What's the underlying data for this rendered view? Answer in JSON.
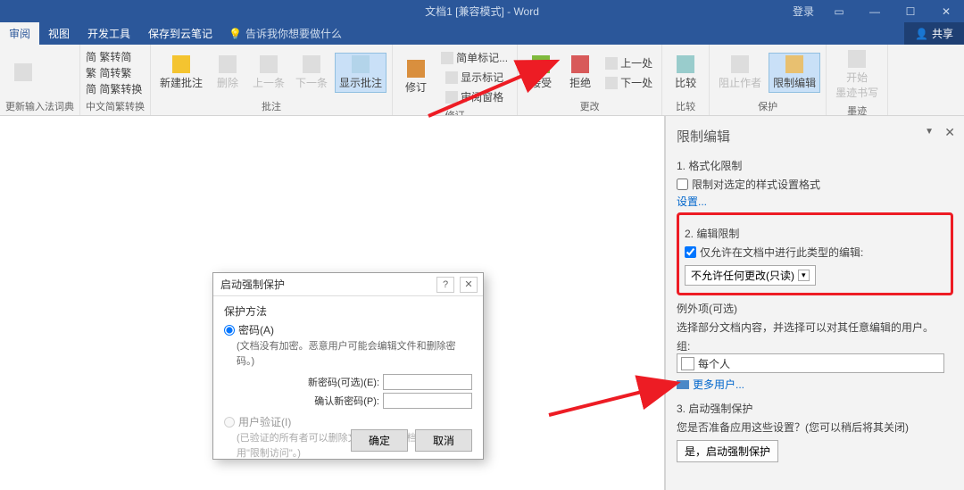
{
  "title": "文档1 [兼容模式] - Word",
  "login": "登录",
  "share": "共享",
  "tabs": {
    "review": "审阅",
    "view": "视图",
    "devtools": "开发工具",
    "save": "保存到云笔记",
    "tell": "告诉我你想要做什么"
  },
  "ribbon": {
    "group1_label": "更新输入法词典",
    "conv": {
      "a": "简 繁转简",
      "b": "繁 简转繁",
      "c": "简 简繁转换",
      "label": "中文简繁转换"
    },
    "comments": {
      "new": "新建批注",
      "del": "删除",
      "prev": "上一条",
      "next": "下一条",
      "show": "显示批注",
      "label": "批注"
    },
    "track": {
      "revise": "修订",
      "a": "简单标记...",
      "b": "显示标记",
      "c": "审阅窗格",
      "label": "修订"
    },
    "changes": {
      "accept": "接受",
      "reject": "拒绝",
      "prev": "上一处",
      "next": "下一处",
      "label": "更改"
    },
    "compare": {
      "btn": "比较",
      "label": "比较"
    },
    "protect": {
      "block": "阻止作者",
      "restrict": "限制编辑",
      "label": "保护"
    },
    "ink": {
      "btn": "开始\n墨迹书写",
      "label": "墨迹"
    }
  },
  "pane": {
    "title": "限制编辑",
    "s1": "1. 格式化限制",
    "s1_chk": "限制对选定的样式设置格式",
    "s1_link": "设置...",
    "s2": "2. 编辑限制",
    "s2_chk": "仅允许在文档中进行此类型的编辑:",
    "s2_select": "不允许任何更改(只读)",
    "exc_h": "例外项(可选)",
    "exc_desc": "选择部分文档内容，并选择可以对其任意编辑的用户。",
    "exc_group": "组:",
    "exc_everyone": "每个人",
    "more_users": "更多用户...",
    "s3": "3. 启动强制保护",
    "s3_desc": "您是否准备应用这些设置？(您可以稍后将其关闭)",
    "s3_btn": "是，启动强制保护"
  },
  "dialog": {
    "title": "启动强制保护",
    "method": "保护方法",
    "pw": "密码(A)",
    "pw_desc": "(文档没有加密。恶意用户可能会编辑文件和删除密码。)",
    "new_pw": "新密码(可选)(E):",
    "confirm_pw": "确认新密码(P):",
    "auth": "用户验证(I)",
    "auth_desc": "(已验证的所有者可以删除文档保护。文档被加密并启用\"限制访问\"。)",
    "ok": "确定",
    "cancel": "取消"
  }
}
